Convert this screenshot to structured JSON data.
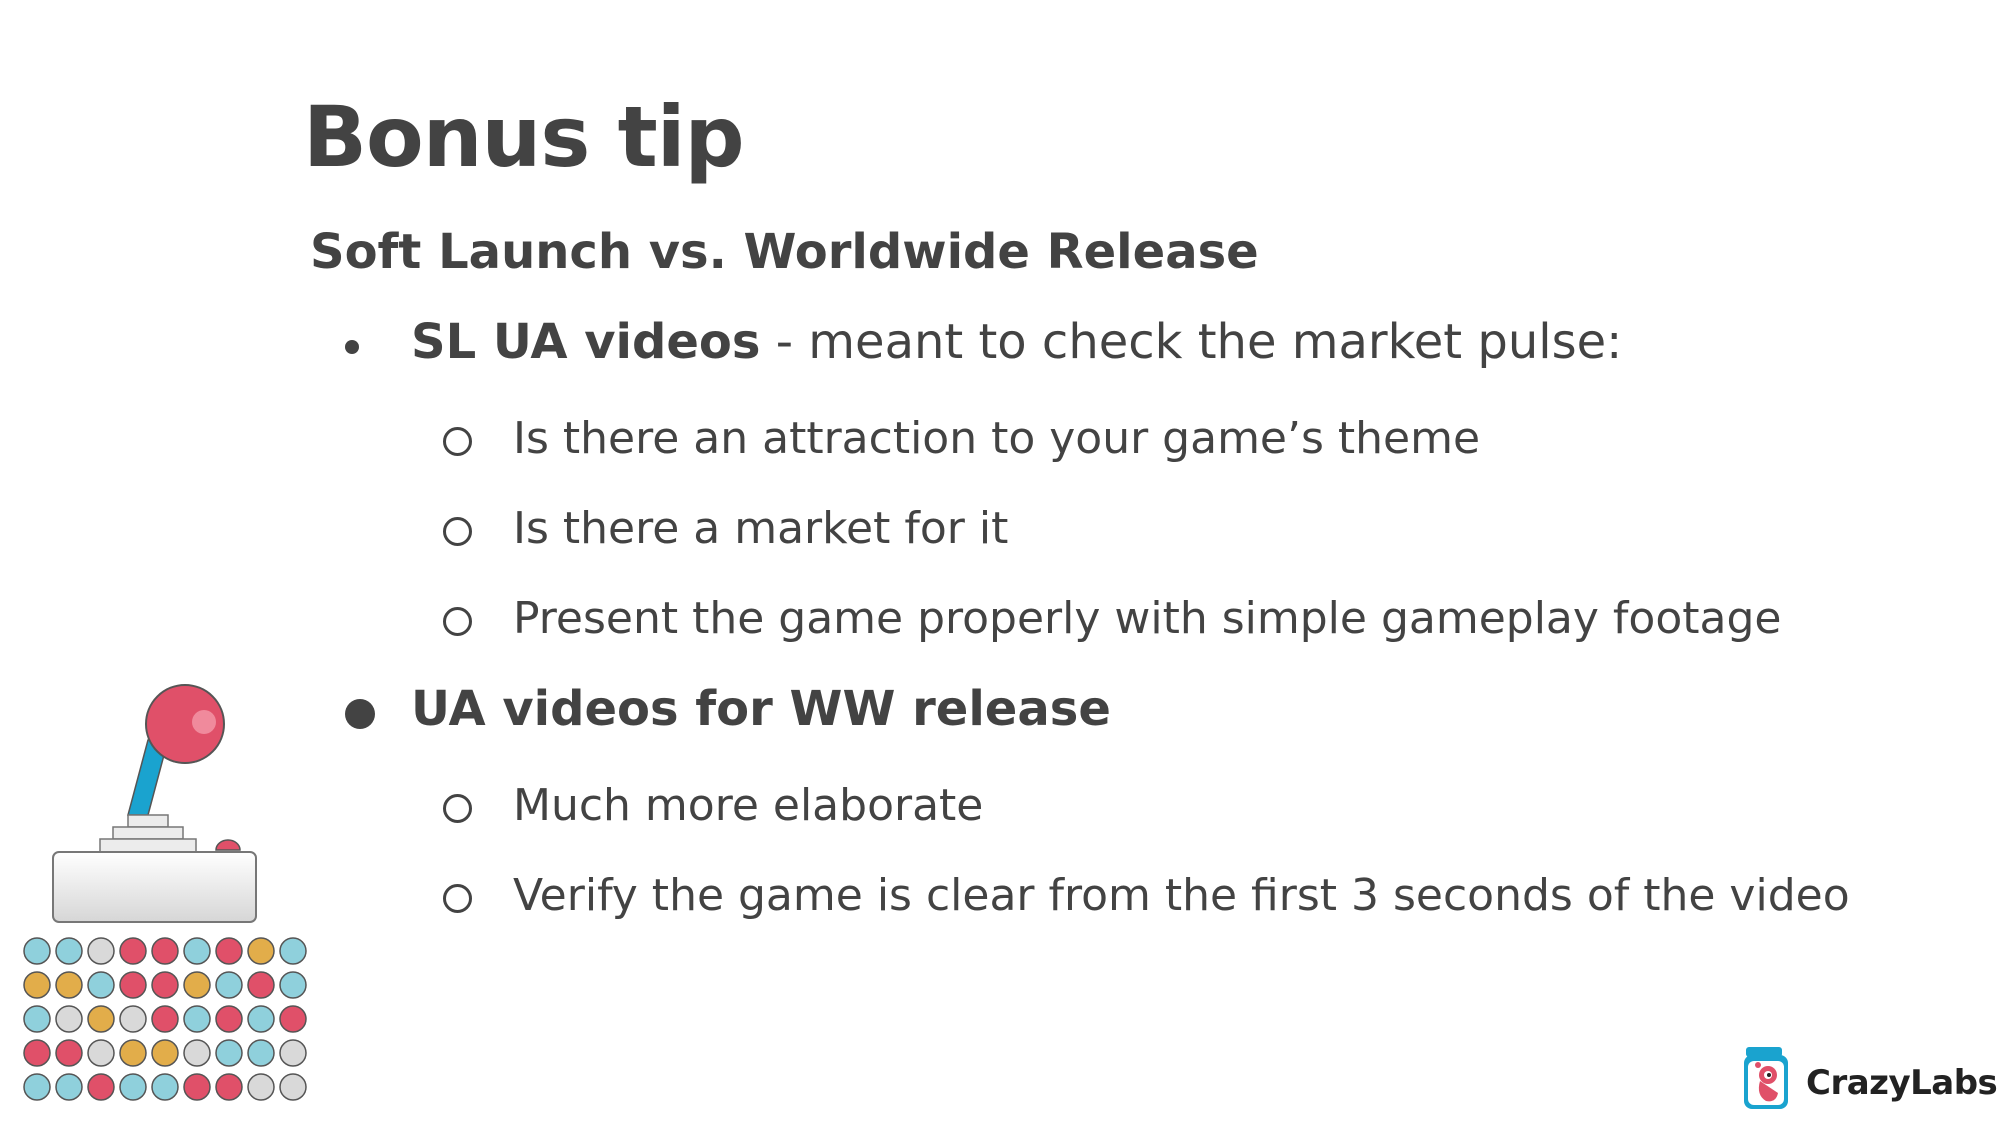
{
  "slide": {
    "title": "Bonus tip",
    "subtitle": "Soft Launch vs. Worldwide Release",
    "bullets": [
      {
        "bold": "SL UA videos",
        "rest": " - meant to check the market pulse:",
        "subitems": [
          "Is there an attraction to your game’s theme",
          "Is there a market for it",
          "Present the game properly with simple gameplay footage"
        ]
      },
      {
        "bold": "UA videos for WW release",
        "rest": "",
        "subitems": [
          "Much more elaborate",
          "Verify the game is clear from the first 3 seconds of the video"
        ]
      }
    ]
  },
  "logo": {
    "name": "CrazyLabs"
  },
  "colors": {
    "text": "#434343",
    "red": "#e05069",
    "blue": "#8fd0dc",
    "yellow": "#e2ad4a",
    "gray": "#d9d9d9",
    "stick": "#1aa3cf"
  }
}
